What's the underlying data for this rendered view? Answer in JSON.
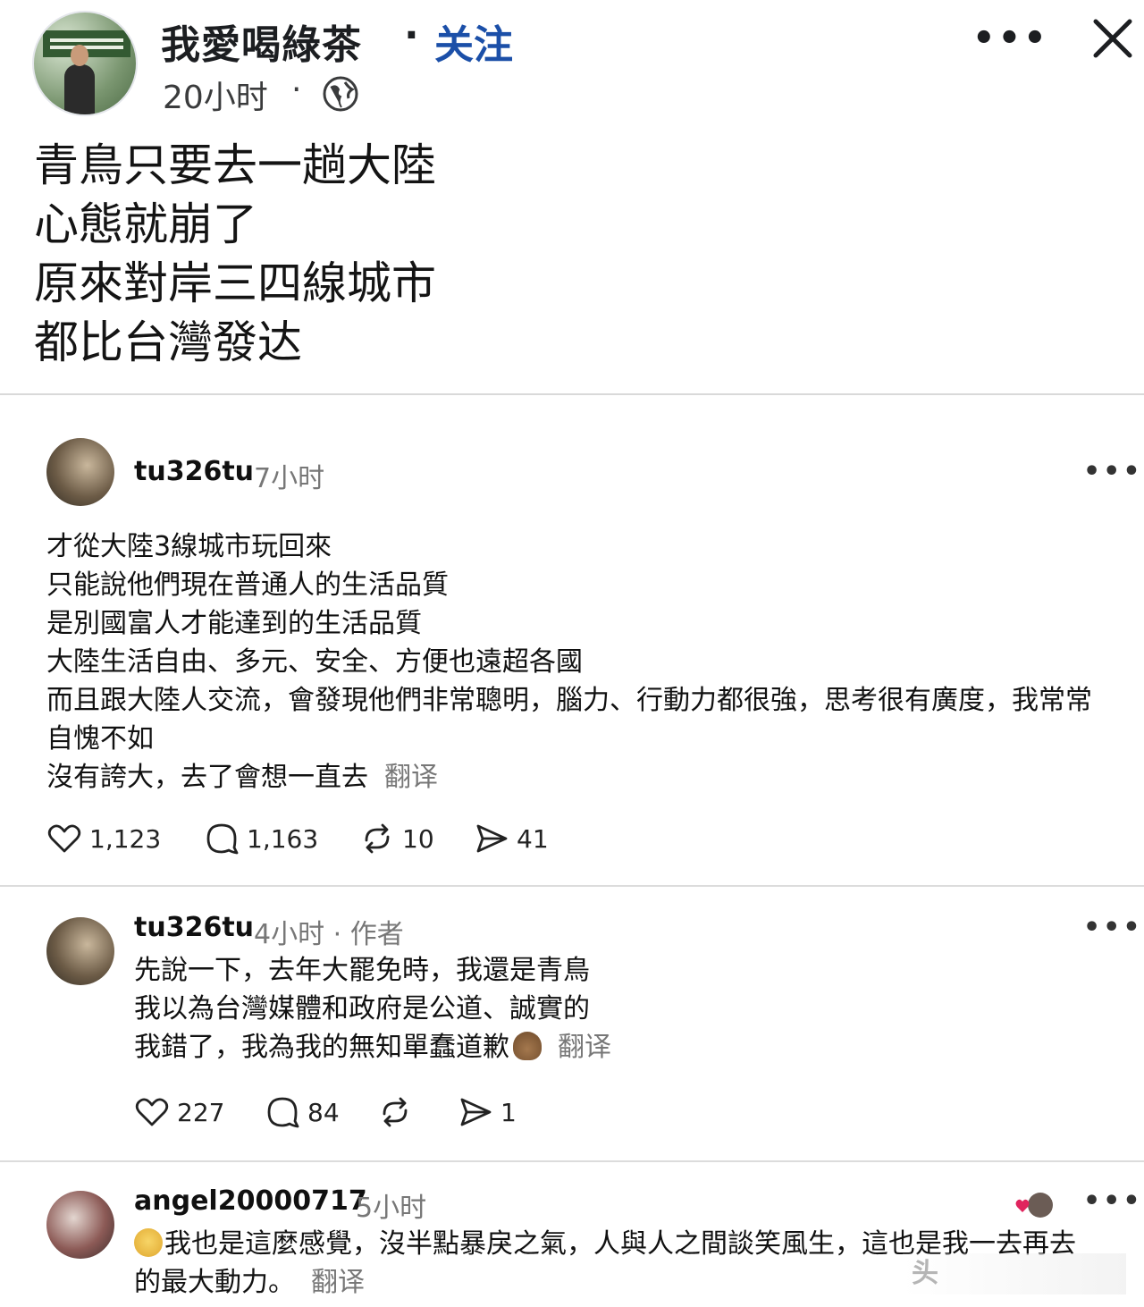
{
  "post": {
    "author": "我愛喝綠茶",
    "separator": "·",
    "follow_label": "关注",
    "time": "20小时",
    "time_separator": "·",
    "more_label": "•••",
    "lines": [
      "青鳥只要去一趟大陸",
      "心態就崩了",
      "原來對岸三四線城市",
      "都比台灣發达"
    ]
  },
  "comments": [
    {
      "username": "tu326tu",
      "meta": "7小时",
      "more_label": "•••",
      "lines": [
        "才從大陸3線城市玩回來",
        "只能說他們現在普通人的生活品質",
        "是別國富人才能達到的生活品質",
        "大陸生活自由、多元、安全、方便也遠超各國",
        "而且跟大陸人交流，會發現他們非常聰明，腦力、行動力都很強，思考很有廣度，我常常",
        "自愧不如",
        "沒有誇大，去了會想一直去"
      ],
      "translate_label": "翻译",
      "likes": "1,123",
      "replies": "1,163",
      "reposts": "10",
      "shares": "41"
    },
    {
      "username": "tu326tu",
      "meta": "4小时 · 作者",
      "more_label": "•••",
      "lines": [
        "先說一下，去年大罷免時，我還是青鳥",
        "我以為台灣媒體和政府是公道、誠實的",
        "我錯了，我為我的無知單蠢道歉"
      ],
      "translate_label": "翻译",
      "likes": "227",
      "replies": "84",
      "reposts": "",
      "shares": "1"
    },
    {
      "username": "angel20000717",
      "meta": "5小时",
      "more_label": "•••",
      "lines": [
        "我也是這麼感覺，沒半點暴戾之氣，人與人之間談笑風生，這也是我一去再去",
        "的最大動力。"
      ],
      "translate_label": "翻译"
    }
  ],
  "icons": {
    "globe": "globe-icon",
    "close": "close-icon",
    "like": "heart-icon",
    "reply": "comment-icon",
    "repost": "repost-icon",
    "share": "send-icon"
  },
  "colors": {
    "follow": "#1b4fa8",
    "meta": "#777777"
  },
  "watermark": "头"
}
